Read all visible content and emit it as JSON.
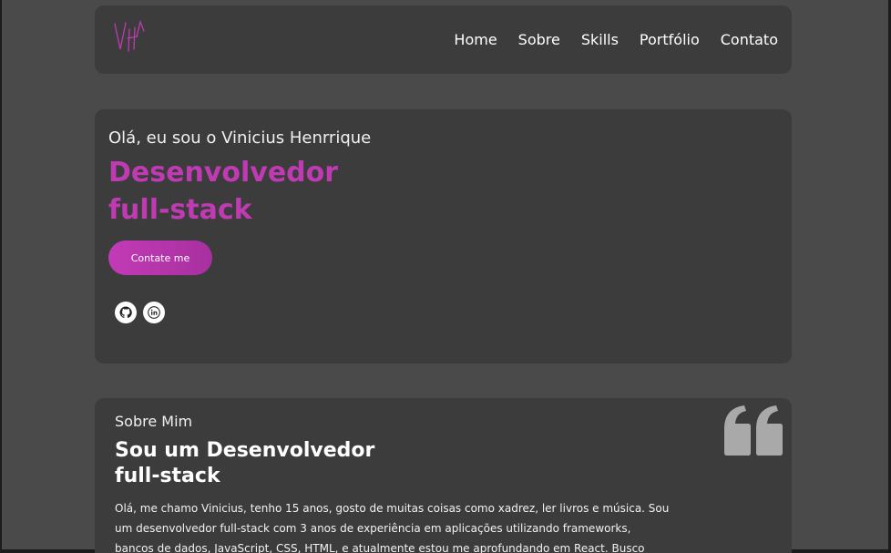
{
  "header": {
    "logo_text": "VH",
    "nav": [
      "Home",
      "Sobre",
      "Skills",
      "Portfólio",
      "Contato"
    ]
  },
  "hero": {
    "greeting": "Olá, eu sou o Vinicius Henrrique",
    "title_line1": "Desenvolvedor",
    "title_line2": "full-stack",
    "cta_label": "Contate me",
    "socials": [
      "github-icon",
      "linkedin-icon"
    ]
  },
  "about": {
    "label": "Sobre Mim",
    "title_line1": "Sou um Desenvolvedor",
    "title_line2": "full-stack",
    "text": "Olá, me chamo Vinicius, tenho 15 anos, gosto de muitas coisas como xadrez, ler livros e música. Sou um desenvolvedor full-stack com 3 anos de experiência em aplicações utilizando frameworks, bancos de dados, JavaScript, CSS, HTML, e atualmente estou me aprofundando em React. Busco uma oportunidade"
  },
  "colors": {
    "accent": "#c03ab3",
    "background": "#4a4a4a",
    "card": "#3c3c3c"
  }
}
